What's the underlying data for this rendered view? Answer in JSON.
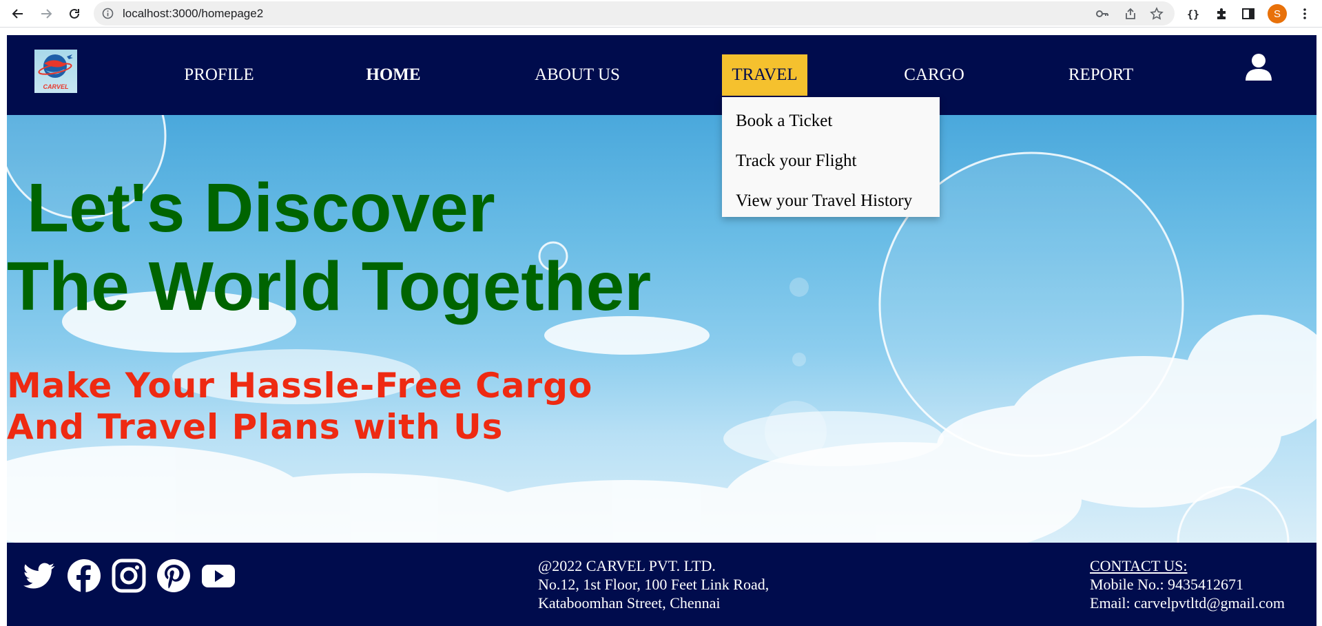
{
  "browser": {
    "url": "localhost:3000/homepage2",
    "profile_initial": "S"
  },
  "navbar": {
    "logo_text": "CARVEL",
    "items": [
      {
        "label": "PROFILE"
      },
      {
        "label": "HOME"
      },
      {
        "label": "ABOUT US"
      },
      {
        "label": "TRAVEL"
      },
      {
        "label": "CARGO"
      },
      {
        "label": "REPORT"
      }
    ],
    "active_color": "#f5c12e",
    "bg_color": "#000c4d"
  },
  "dropdown": {
    "items": [
      {
        "label": "Book a Ticket"
      },
      {
        "label": "Track your Flight"
      },
      {
        "label": "View your Travel History"
      }
    ]
  },
  "hero": {
    "title_line1": "Let's Discover",
    "title_line2": "The World Together",
    "subtitle_line1": "Make Your Hassle-Free Cargo",
    "subtitle_line2": "And Travel Plans with Us",
    "title_color": "#006400",
    "subtitle_color": "#ee2a12"
  },
  "footer": {
    "social_icons": [
      "twitter-icon",
      "facebook-icon",
      "instagram-icon",
      "pinterest-icon",
      "youtube-icon"
    ],
    "company": "@2022 CARVEL PVT. LTD.",
    "address_line1": "No.12, 1st Floor, 100 Feet Link Road,",
    "address_line2": "Kataboomhan Street, Chennai",
    "contact_heading": "CONTACT US:",
    "mobile": "Mobile No.: 9435412671",
    "email": "Email: carvelpvtltd@gmail.com"
  }
}
